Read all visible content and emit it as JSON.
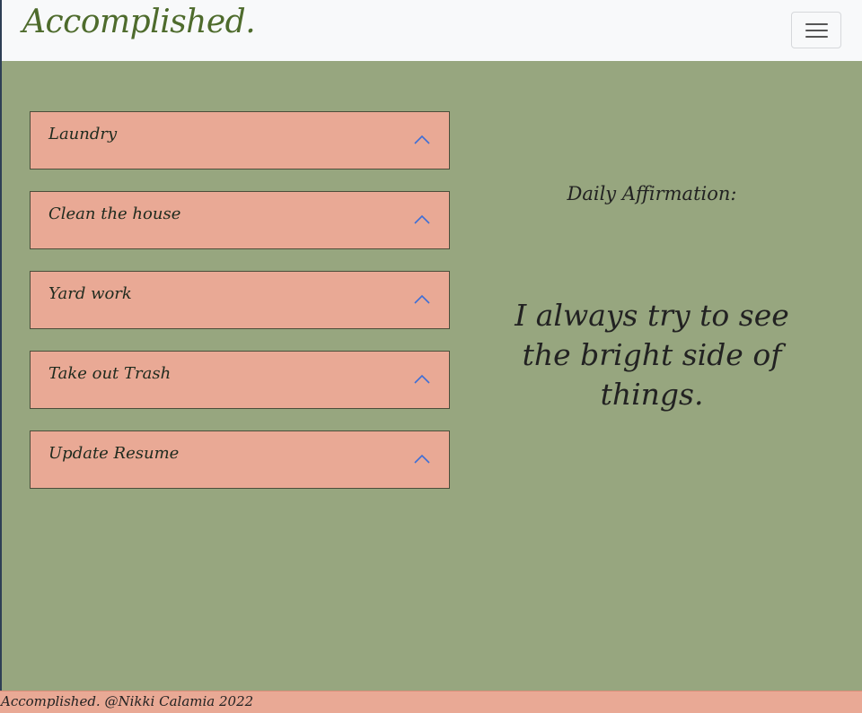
{
  "brand": {
    "name": "Accomplished."
  },
  "navbar": {
    "toggler_icon": "hamburger-menu-icon"
  },
  "tasks": [
    {
      "label": "Laundry",
      "icon": "chevron-up-icon"
    },
    {
      "label": "Clean the house",
      "icon": "chevron-up-icon"
    },
    {
      "label": "Yard work",
      "icon": "chevron-up-icon"
    },
    {
      "label": "Take out Trash",
      "icon": "chevron-up-icon"
    },
    {
      "label": "Update Resume",
      "icon": "chevron-up-icon"
    }
  ],
  "affirmation": {
    "title": "Daily Affirmation:",
    "text": "I always try to see the bright side of things."
  },
  "footer": {
    "text": "Accomplished. @Nikki Calamia 2022"
  },
  "colors": {
    "page_background": "#97a67f",
    "task_background": "#e9a995",
    "brand_green": "#4e6b2c",
    "chevron_blue": "#3f6fd6"
  }
}
